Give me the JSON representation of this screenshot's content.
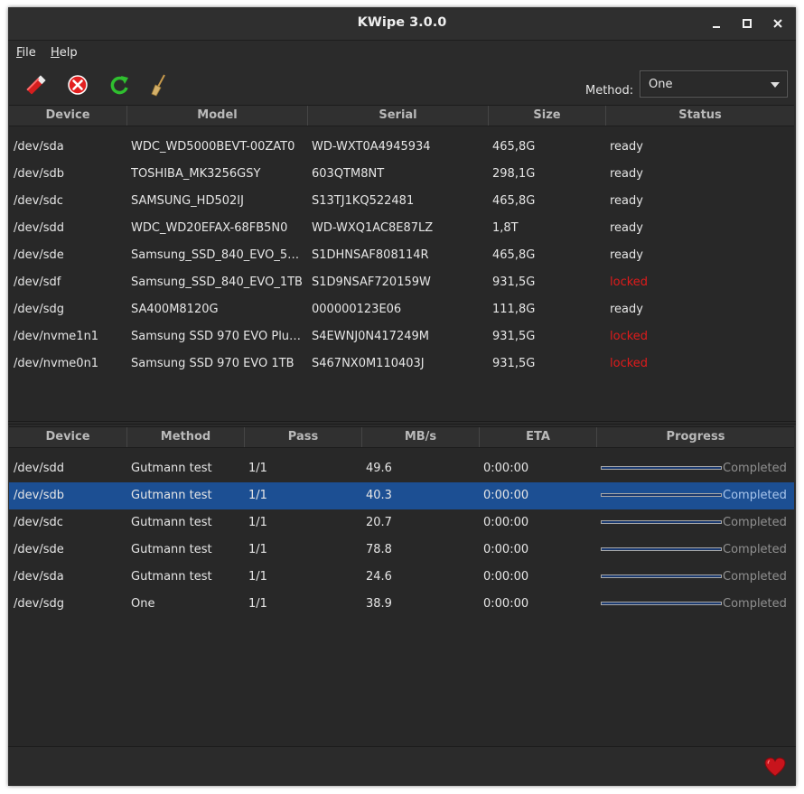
{
  "window": {
    "title": "KWipe 3.0.0"
  },
  "menu": [
    {
      "mnemonic": "F",
      "rest": "ile"
    },
    {
      "mnemonic": "H",
      "rest": "elp"
    }
  ],
  "toolbar": {
    "method_label": "Method:",
    "method_value": "One"
  },
  "devices": {
    "columns": [
      "Device",
      "Model",
      "Serial",
      "Size",
      "Status"
    ],
    "rows": [
      {
        "device": "/dev/sda",
        "model": "WDC_WD5000BEVT-00ZAT0",
        "serial": "WD-WXT0A4945934",
        "size": "465,8G",
        "status": "ready"
      },
      {
        "device": "/dev/sdb",
        "model": "TOSHIBA_MK3256GSY",
        "serial": "603QTM8NT",
        "size": "298,1G",
        "status": "ready"
      },
      {
        "device": "/dev/sdc",
        "model": "SAMSUNG_HD502IJ",
        "serial": "S13TJ1KQ522481",
        "size": "465,8G",
        "status": "ready"
      },
      {
        "device": "/dev/sdd",
        "model": "WDC_WD20EFAX-68FB5N0",
        "serial": "WD-WXQ1AC8E87LZ",
        "size": "1,8T",
        "status": "ready"
      },
      {
        "device": "/dev/sde",
        "model": "Samsung_SSD_840_EVO_5…",
        "serial": "S1DHNSAF808114R",
        "size": "465,8G",
        "status": "ready"
      },
      {
        "device": "/dev/sdf",
        "model": "Samsung_SSD_840_EVO_1TB",
        "serial": "S1D9NSAF720159W",
        "size": "931,5G",
        "status": "locked"
      },
      {
        "device": "/dev/sdg",
        "model": "SA400M8120G",
        "serial": "000000123E06",
        "size": "111,8G",
        "status": "ready"
      },
      {
        "device": "/dev/nvme1n1",
        "model": "Samsung SSD 970 EVO Plu…",
        "serial": "S4EWNJ0N417249M",
        "size": "931,5G",
        "status": "locked"
      },
      {
        "device": "/dev/nvme0n1",
        "model": "Samsung SSD 970 EVO 1TB",
        "serial": "S467NX0M110403J",
        "size": "931,5G",
        "status": "locked"
      }
    ]
  },
  "jobs": {
    "columns": [
      "Device",
      "Method",
      "Pass",
      "MB/s",
      "ETA",
      "Progress"
    ],
    "rows": [
      {
        "device": "/dev/sdd",
        "method": "Gutmann test",
        "pass": "1/1",
        "mbs": "49.6",
        "eta": "0:00:00",
        "progress": 1.0,
        "progress_label": "Completed",
        "selected": false
      },
      {
        "device": "/dev/sdb",
        "method": "Gutmann test",
        "pass": "1/1",
        "mbs": "40.3",
        "eta": "0:00:00",
        "progress": 1.0,
        "progress_label": "Completed",
        "selected": true
      },
      {
        "device": "/dev/sdc",
        "method": "Gutmann test",
        "pass": "1/1",
        "mbs": "20.7",
        "eta": "0:00:00",
        "progress": 1.0,
        "progress_label": "Completed",
        "selected": false
      },
      {
        "device": "/dev/sde",
        "method": "Gutmann test",
        "pass": "1/1",
        "mbs": "78.8",
        "eta": "0:00:00",
        "progress": 1.0,
        "progress_label": "Completed",
        "selected": false
      },
      {
        "device": "/dev/sda",
        "method": "Gutmann test",
        "pass": "1/1",
        "mbs": "24.6",
        "eta": "0:00:00",
        "progress": 1.0,
        "progress_label": "Completed",
        "selected": false
      },
      {
        "device": "/dev/sdg",
        "method": "One",
        "pass": "1/1",
        "mbs": "38.9",
        "eta": "0:00:00",
        "progress": 1.0,
        "progress_label": "Completed",
        "selected": false
      }
    ]
  },
  "colors": {
    "locked": "#e01b1b",
    "selection": "#1c4f93",
    "progress": "#1b3a70"
  },
  "icons": [
    "wipe-icon",
    "cancel-icon",
    "refresh-icon",
    "broom-icon",
    "heart-icon"
  ]
}
